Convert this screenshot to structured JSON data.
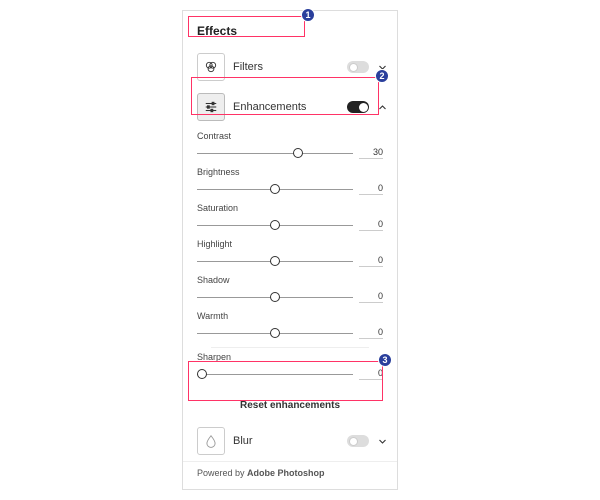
{
  "section_title": "Effects",
  "filters": {
    "label": "Filters",
    "enabled": false,
    "expanded": false
  },
  "enhancements": {
    "label": "Enhancements",
    "enabled": true,
    "expanded": true,
    "sliders": [
      {
        "label": "Contrast",
        "value": 30,
        "pos": 65
      },
      {
        "label": "Brightness",
        "value": 0,
        "pos": 50
      },
      {
        "label": "Saturation",
        "value": 0,
        "pos": 50
      },
      {
        "label": "Highlight",
        "value": 0,
        "pos": 50
      },
      {
        "label": "Shadow",
        "value": 0,
        "pos": 50
      },
      {
        "label": "Warmth",
        "value": 0,
        "pos": 50
      },
      {
        "label": "Sharpen",
        "value": 0,
        "pos": 3
      }
    ],
    "reset_label": "Reset enhancements"
  },
  "blur": {
    "label": "Blur",
    "enabled": false,
    "expanded": false
  },
  "footer_prefix": "Powered by ",
  "footer_brand": "Adobe Photoshop",
  "callouts": [
    {
      "n": "1",
      "box": {
        "l": 188,
        "t": 16,
        "w": 117,
        "h": 21
      },
      "badge": {
        "l": 301,
        "t": 8
      }
    },
    {
      "n": "2",
      "box": {
        "l": 191,
        "t": 77,
        "w": 188,
        "h": 38
      },
      "badge": {
        "l": 375,
        "t": 69
      }
    },
    {
      "n": "3",
      "box": {
        "l": 188,
        "t": 361,
        "w": 195,
        "h": 40
      },
      "badge": {
        "l": 378,
        "t": 353
      }
    }
  ]
}
